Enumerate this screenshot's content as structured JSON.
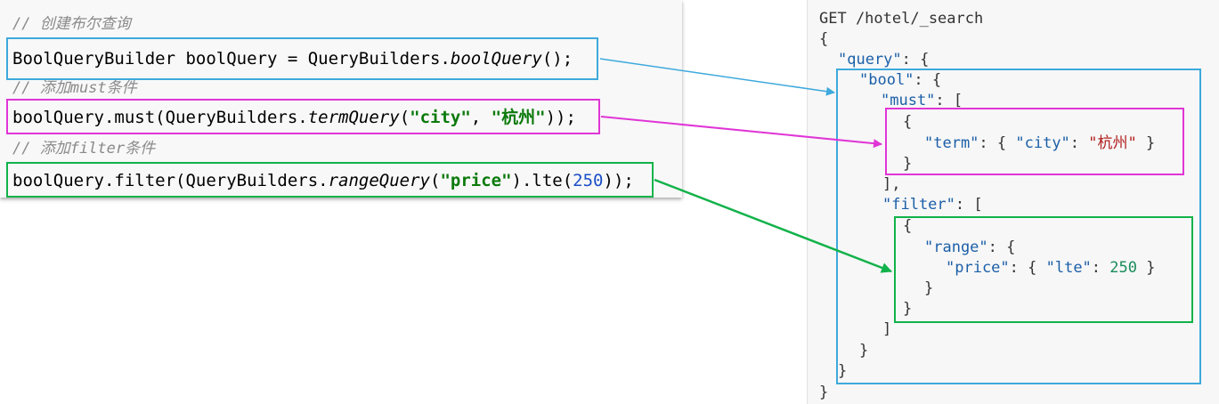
{
  "java_code": {
    "comment_create": "// 创建布尔查询",
    "line_create": {
      "prefix": "BoolQueryBuilder boolQuery = QueryBuilders.",
      "method": "boolQuery",
      "suffix": "();"
    },
    "comment_must": "// 添加must条件",
    "line_must": {
      "prefix": "boolQuery.must(QueryBuilders.",
      "method": "termQuery",
      "open": "(",
      "arg1": "\"city\"",
      "sep": ", ",
      "arg2": "\"杭州\"",
      "suffix": "));"
    },
    "comment_filter": "// 添加filter条件",
    "line_filter": {
      "prefix": "boolQuery.filter(QueryBuilders.",
      "method": "rangeQuery",
      "open": "(",
      "arg1": "\"price\"",
      "mid": ").lte(",
      "num": "250",
      "suffix": "));"
    }
  },
  "dsl": {
    "request_line": "GET /hotel/_search",
    "brace_open": "{",
    "query_key": "\"query\"",
    "bool_key": "\"bool\"",
    "must_key": "\"must\"",
    "term_key": "\"term\"",
    "city_key": "\"city\"",
    "city_value": "\"杭州\"",
    "filter_key": "\"filter\"",
    "range_key": "\"range\"",
    "price_key": "\"price\"",
    "lte_key": "\"lte\"",
    "lte_value": "250",
    "brace_close": "}"
  },
  "colors": {
    "create_box": "#3ea9dc",
    "must_box": "#e035d6",
    "filter_box": "#12b24a"
  }
}
